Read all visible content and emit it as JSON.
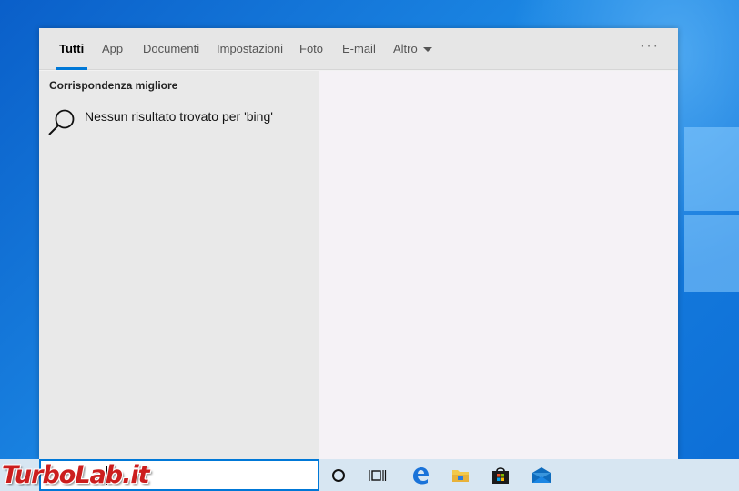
{
  "tabs": [
    {
      "label": "Tutti",
      "active": true
    },
    {
      "label": "App"
    },
    {
      "label": "Documenti"
    },
    {
      "label": "Impostazioni"
    },
    {
      "label": "Foto"
    },
    {
      "label": "E-mail"
    },
    {
      "label": "Altro"
    }
  ],
  "more_label": "···",
  "best_match": {
    "title": "Corrispondenza migliore",
    "result_text": "Nessun risultato trovato per 'bing'",
    "icon": "search-icon"
  },
  "taskbar": {
    "icons": [
      "cortana-icon",
      "task-view-icon",
      "edge-icon",
      "file-explorer-icon",
      "store-icon",
      "mail-icon"
    ]
  },
  "watermark": "TurboLab.it",
  "colors": {
    "accent": "#0078d7",
    "desktop": "#1b86e3",
    "watermark": "#cc1e1e"
  }
}
